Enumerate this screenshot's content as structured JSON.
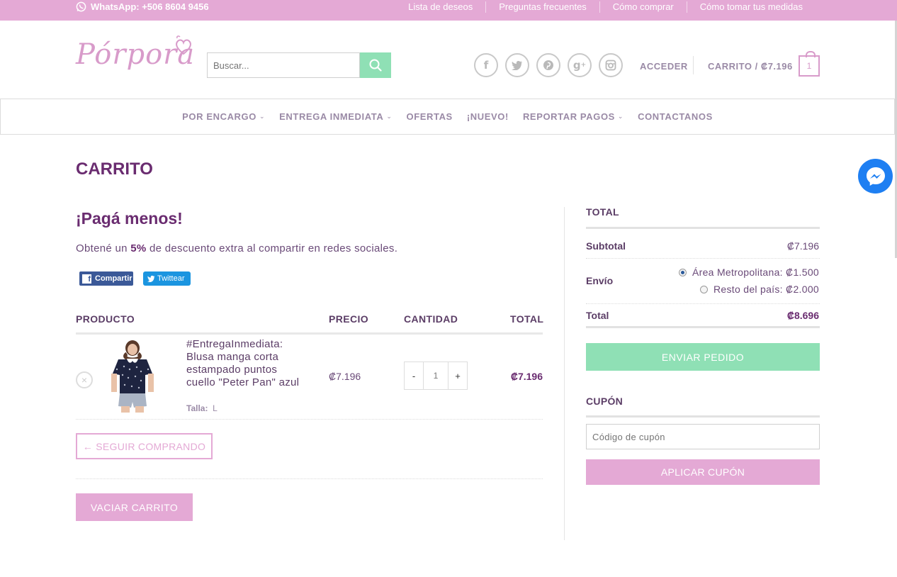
{
  "topbar": {
    "whatsapp": "WhatsApp: +506 8604 9456",
    "links": [
      "Lista de deseos",
      "Preguntas frecuentes",
      "Cómo comprar",
      "Cómo tomar tus medidas"
    ]
  },
  "header": {
    "logo_text": "Pórpora",
    "search_placeholder": "Buscar...",
    "social_icons": [
      "facebook-icon",
      "twitter-icon",
      "pinterest-icon",
      "google-plus-icon",
      "instagram-icon"
    ],
    "login_label": "ACCEDER",
    "cart_label": "CARRITO / ₡7.196",
    "cart_count": "1"
  },
  "nav": {
    "items": [
      {
        "label": "POR ENCARGO",
        "has_dropdown": true
      },
      {
        "label": "ENTREGA INMEDIATA",
        "has_dropdown": true
      },
      {
        "label": "OFERTAS",
        "has_dropdown": false
      },
      {
        "label": "¡NUEVO!",
        "has_dropdown": false
      },
      {
        "label": "REPORTAR PAGOS",
        "has_dropdown": true
      },
      {
        "label": "CONTACTANOS",
        "has_dropdown": false
      }
    ]
  },
  "page": {
    "title": "CARRITO"
  },
  "promo": {
    "title": "¡Pagá menos!",
    "text_before": "Obtené un ",
    "text_bold": "5%",
    "text_after": " de descuento extra al compartir en redes sociales.",
    "facebook_label": "Compartir",
    "twitter_label": "Twittear"
  },
  "cart_table": {
    "headers": {
      "product": "PRODUCTO",
      "price": "PRECIO",
      "quantity": "CANTIDAD",
      "total": "TOTAL"
    },
    "rows": [
      {
        "name": "#EntregaInmediata: Blusa manga corta estampado puntos cuello \"Peter Pan\" azul",
        "variation_label": "Talla:",
        "variation_value": "L",
        "price": "₡7.196",
        "quantity": "1",
        "total": "₡7.196"
      }
    ],
    "qty_minus": "-",
    "qty_plus": "+",
    "continue_label": "← SEGUIR COMPRANDO",
    "empty_label": "VACIAR CARRITO"
  },
  "totals": {
    "title": "TOTAL",
    "subtotal_label": "Subtotal",
    "subtotal_value": "₡7.196",
    "shipping_label": "Envío",
    "shipping_options": [
      {
        "label": "Área Metropolitana: ₡1.500",
        "selected": true
      },
      {
        "label": "Resto del país: ₡2.000",
        "selected": false
      }
    ],
    "total_label": "Total",
    "total_value": "₡8.696",
    "checkout_label": "ENVIAR PEDIDO"
  },
  "coupon": {
    "title": "CUPÓN",
    "placeholder": "Código de cupón",
    "apply_label": "APLICAR CUPÓN"
  },
  "colors": {
    "brand_pink": "#e4a9d5",
    "brand_purple": "#6a2c70",
    "mint": "#8fe0b5",
    "messenger_blue": "#1e7ff2"
  }
}
